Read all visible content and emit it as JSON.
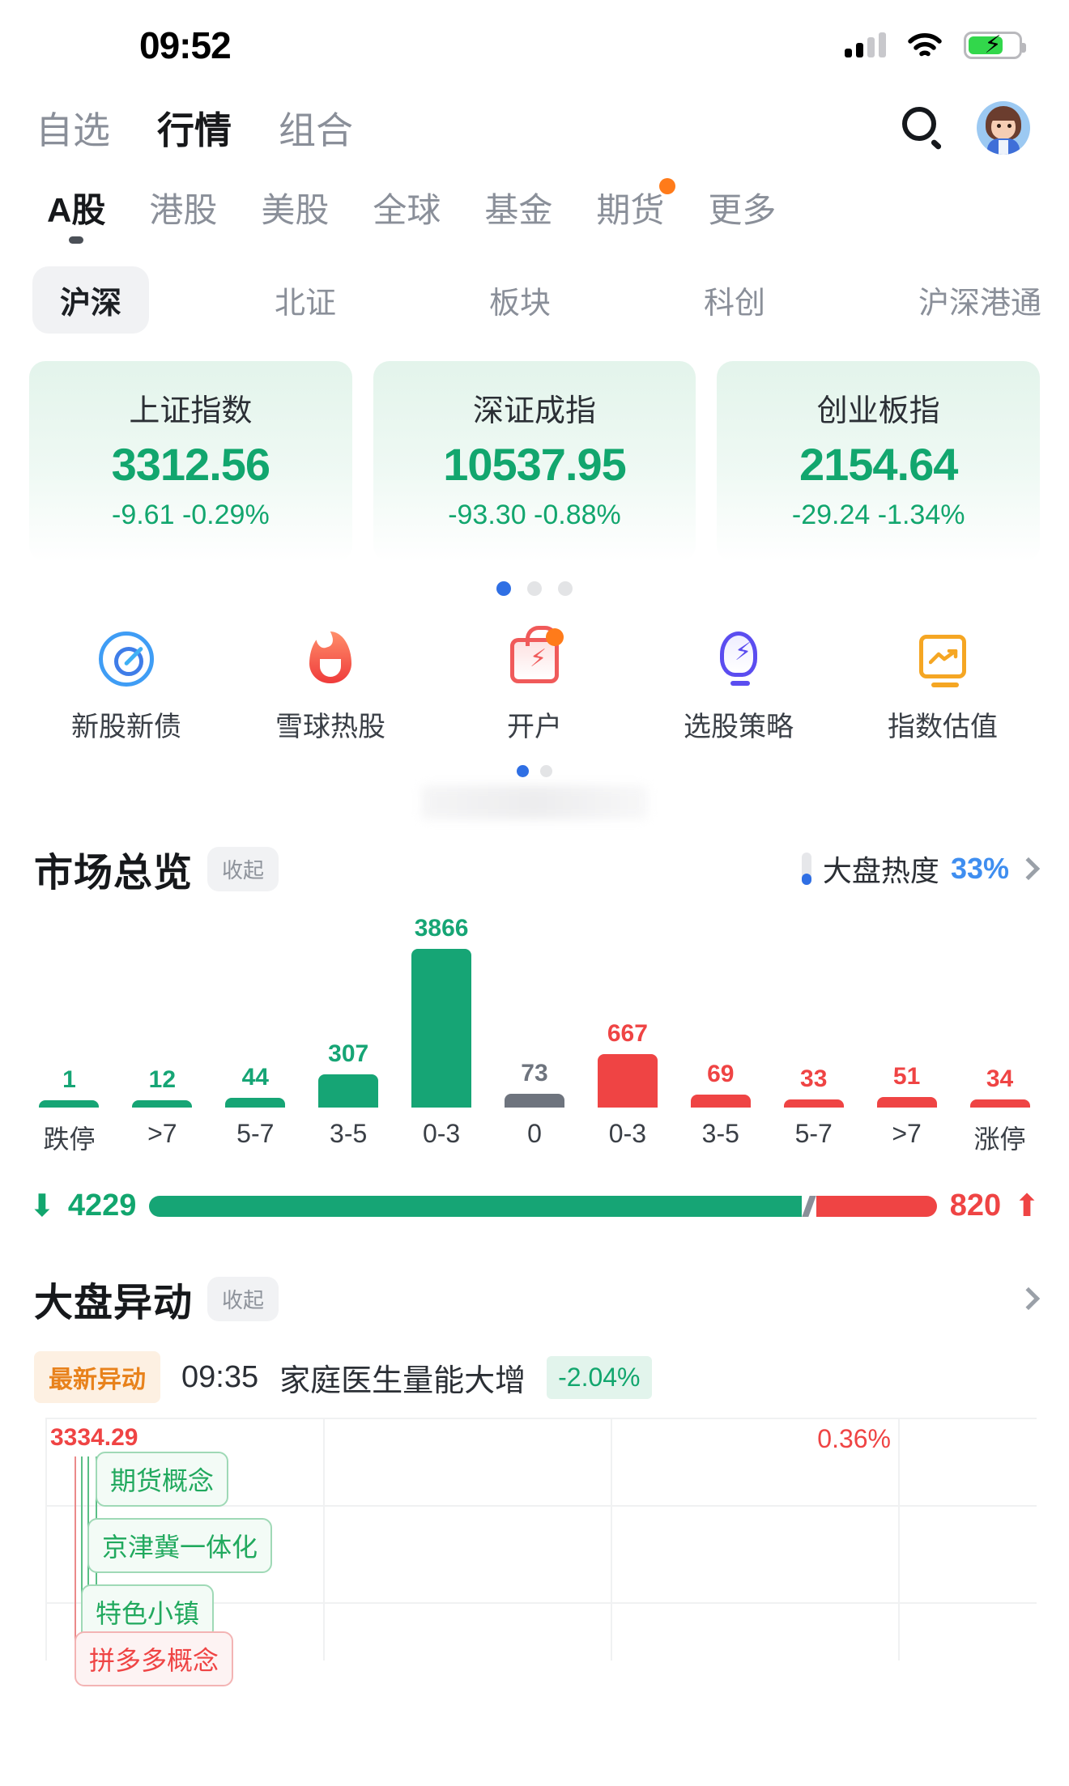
{
  "status_bar": {
    "time": "09:52",
    "wifi_icon": "wifi-icon",
    "battery_icon": "battery-charging-icon",
    "signal_icon": "cellular-signal-icon"
  },
  "top_nav": {
    "items": [
      {
        "label": "自选",
        "active": false
      },
      {
        "label": "行情",
        "active": true
      },
      {
        "label": "组合",
        "active": false
      }
    ],
    "search_icon": "search-icon",
    "avatar_icon": "user-avatar"
  },
  "market_tabs": [
    {
      "label": "A股",
      "active": true,
      "badge": false
    },
    {
      "label": "港股",
      "active": false,
      "badge": false
    },
    {
      "label": "美股",
      "active": false,
      "badge": false
    },
    {
      "label": "全球",
      "active": false,
      "badge": false
    },
    {
      "label": "基金",
      "active": false,
      "badge": false
    },
    {
      "label": "期货",
      "active": false,
      "badge": true
    },
    {
      "label": "更多",
      "active": false,
      "badge": false
    }
  ],
  "sub_tabs": [
    {
      "label": "沪深",
      "active": true
    },
    {
      "label": "北证",
      "active": false
    },
    {
      "label": "板块",
      "active": false
    },
    {
      "label": "科创",
      "active": false
    },
    {
      "label": "沪深港通",
      "active": false
    }
  ],
  "index_cards": [
    {
      "name": "上证指数",
      "price": "3312.56",
      "change": "-9.61 -0.29%"
    },
    {
      "name": "深证成指",
      "price": "10537.95",
      "change": "-93.30 -0.88%"
    },
    {
      "name": "创业板指",
      "price": "2154.64",
      "change": "-29.24 -1.34%"
    }
  ],
  "card_pager": {
    "total": 3,
    "active": 1
  },
  "quick_actions": [
    {
      "label": "新股新债",
      "icon": "target-dart-icon",
      "badge": false
    },
    {
      "label": "雪球热股",
      "icon": "flame-icon",
      "badge": false
    },
    {
      "label": "开户",
      "icon": "briefcase-bolt-icon",
      "badge": true
    },
    {
      "label": "选股策略",
      "icon": "lightbulb-bolt-icon",
      "badge": false
    },
    {
      "label": "指数估值",
      "icon": "chart-monitor-icon",
      "badge": false
    }
  ],
  "quick_pager": {
    "total": 2,
    "active": 1
  },
  "market_overview": {
    "title": "市场总览",
    "collapse_label": "收起",
    "heat_label": "大盘热度",
    "heat_value": "33%",
    "chevron_icon": "chevron-right-icon"
  },
  "chart_data": {
    "type": "bar",
    "title": "市场总览 涨跌分布",
    "categories": [
      "跌停",
      ">7",
      "5-7",
      "3-5",
      "0-3",
      "0",
      "0-3",
      "3-5",
      "5-7",
      ">7",
      "涨停"
    ],
    "values": [
      1,
      12,
      44,
      307,
      3866,
      73,
      667,
      69,
      33,
      51,
      34
    ],
    "colors": [
      "#16a575",
      "#16a575",
      "#16a575",
      "#16a575",
      "#16a575",
      "#6e747e",
      "#ef4444",
      "#ef4444",
      "#ef4444",
      "#ef4444",
      "#ef4444"
    ],
    "bar_labels": [
      "1",
      "12",
      "44",
      "307",
      "3866",
      "73",
      "667",
      "69",
      "33",
      "51",
      "34"
    ],
    "ylim": [
      0,
      3866
    ],
    "grid": false,
    "xlabel": "",
    "ylabel": ""
  },
  "updown": {
    "down_value": "4229",
    "up_value": "820",
    "down_arrow": "arrow-down-icon",
    "up_arrow": "arrow-up-icon",
    "down_color": "#12a66e",
    "up_color": "#ef4444"
  },
  "anomaly": {
    "title": "大盘异动",
    "collapse_label": "收起",
    "chevron_icon": "chevron-right-icon",
    "badge": "最新异动",
    "time": "09:35",
    "text": "家庭医生量能大增",
    "change": "-2.04%",
    "chart": {
      "high_label": "3334.29",
      "percent_label": "0.36%",
      "concept_tags": [
        {
          "label": "期货概念",
          "tone": "green"
        },
        {
          "label": "京津冀一体化",
          "tone": "green"
        },
        {
          "label": "特色小镇",
          "tone": "green"
        },
        {
          "label": "拼多多概念",
          "tone": "red"
        }
      ]
    }
  }
}
